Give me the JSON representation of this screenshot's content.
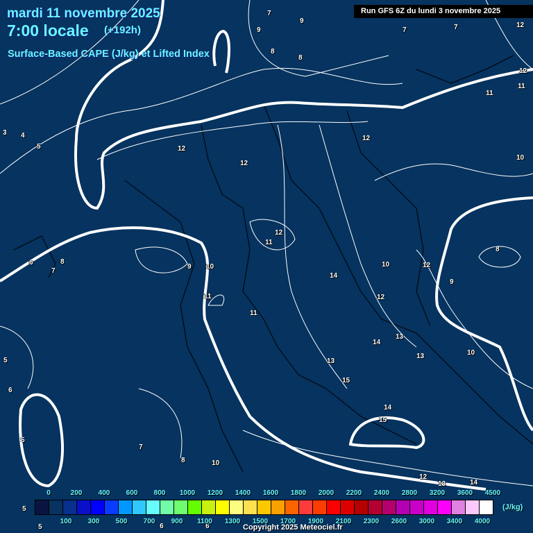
{
  "header": {
    "date": "mardi 11 novembre 2025",
    "time": "7:00 locale",
    "lead": "(+192h)",
    "parameter": "Surface-Based CAPE (J/kg) et Lifted Index",
    "run": "Run GFS 6Z du lundi 3 novembre 2025"
  },
  "contour_labels": [
    "7",
    "9",
    "9",
    "8",
    "8",
    "7",
    "7",
    "12",
    "12",
    "11",
    "11",
    "10",
    "3",
    "4",
    "5",
    "12",
    "12",
    "12",
    "12",
    "11",
    "6",
    "8",
    "7",
    "9",
    "10",
    "11",
    "11",
    "14",
    "10",
    "12",
    "9",
    "8",
    "12",
    "14",
    "13",
    "13",
    "13",
    "10",
    "15",
    "14",
    "15",
    "5",
    "6",
    "5",
    "7",
    "8",
    "10",
    "12",
    "13",
    "14",
    "5",
    "6",
    "5",
    "6"
  ],
  "legend": {
    "unit": "(J/kg)",
    "top_ticks": [
      "0",
      "200",
      "400",
      "600",
      "800",
      "1000",
      "1200",
      "1400",
      "1600",
      "1800",
      "2000",
      "2200",
      "2400",
      "2800",
      "3200",
      "3600",
      "4500"
    ],
    "bottom_ticks": [
      "100",
      "300",
      "500",
      "700",
      "900",
      "1100",
      "1300",
      "1500",
      "1700",
      "1900",
      "2100",
      "2300",
      "2600",
      "3000",
      "3400",
      "4000"
    ],
    "colors": [
      "#0a1440",
      "#06335f",
      "#08308c",
      "#0a10c8",
      "#0000ff",
      "#0a3cff",
      "#0098ff",
      "#30c8ff",
      "#66fcfc",
      "#70fca8",
      "#70fc70",
      "#64fc00",
      "#c8f010",
      "#fcfc00",
      "#fcfc80",
      "#fce050",
      "#fcc800",
      "#fca000",
      "#fc6400",
      "#fc3c3c",
      "#fc3c00",
      "#fc0000",
      "#dc0000",
      "#b40000",
      "#b40032",
      "#b4006c",
      "#b400b4",
      "#c800c8",
      "#e000e0",
      "#fc00fc",
      "#e080e0",
      "#fcc8fc",
      "#ffffff"
    ]
  },
  "copyright": "Copyright 2025 Meteociel.fr"
}
